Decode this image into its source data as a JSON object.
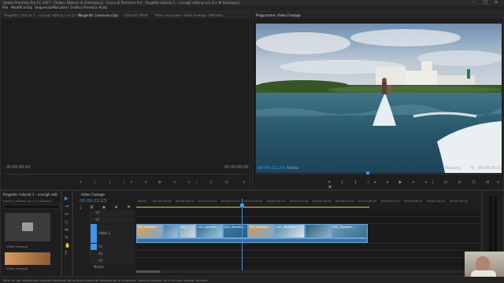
{
  "app": {
    "title": "Adobe Premiere Pro CC 2017 - [Video: Obtenir le Ordinateur] - Corso di Premiere Pro - Progetto tutorial 1 - consigli editing con Q e W [Esempio]",
    "menu": [
      "File",
      "Modifica",
      "Clip",
      "Sequenza",
      "Marcatori",
      "Grafica",
      "Finestra",
      "Aiuto"
    ]
  },
  "source_panel": {
    "tabs": [
      "Progetto: tutorial 1 - consigli editing con Q e W",
      "Sorgente: (nessuna clip)",
      "Controlli effetti",
      "Mixer clip audio: Video Footage",
      "Metadati"
    ],
    "timecode_left": "00:00:00:00",
    "timecode_right": "00:00:00:00"
  },
  "program_panel": {
    "tab": "Programma: Video Footage",
    "timecode": "00:00:22:23",
    "fit": "Adatta",
    "quality": "Massima",
    "duration": "00:00:01:01"
  },
  "project_panel": {
    "tab": "Progetto: tutorial 1 - consigli edit",
    "file": "tutorial_editing con Q e W.prproj",
    "bin_label": "Video Footage",
    "clip_label": "Video Footage"
  },
  "timeline": {
    "tab": "Video Footage",
    "timecode": "00:00:22:23",
    "ruler": [
      "00:00",
      "00:00:04:23",
      "00:00:09:23",
      "00:00:14:23",
      "00:00:19:23",
      "00:00:24:23",
      "00:00:29:23",
      "00:00:34:23",
      "00:00:39:23",
      "00:00:44:23",
      "00:00:49:23",
      "00:00:54:23",
      "00:00:59:22",
      "00:01:04:22",
      "00:01:09:22"
    ],
    "tracks": [
      "V3",
      "V2",
      "V1",
      "A1",
      "A2",
      "A3"
    ],
    "track_label_video": "Video 1",
    "master": "Master",
    "clips": [
      "DSC_Meredith...",
      "DSC_Meredith...",
      "DSC_...",
      "DSC_Meredith...",
      "DSC_Meredith...",
      "DSC_Meredith...",
      "DSC_Meredith..."
    ]
  },
  "status": "Fare clic per selezionare oppure trascinare da un'area vuota per selezionare in selezione. Premere Maiusc, Alt e Ctrl per ulteriori funzioni.",
  "colors": {
    "accent": "#3e96e8",
    "playhead": "#3e96e8",
    "bg": "#1b1b1b"
  }
}
